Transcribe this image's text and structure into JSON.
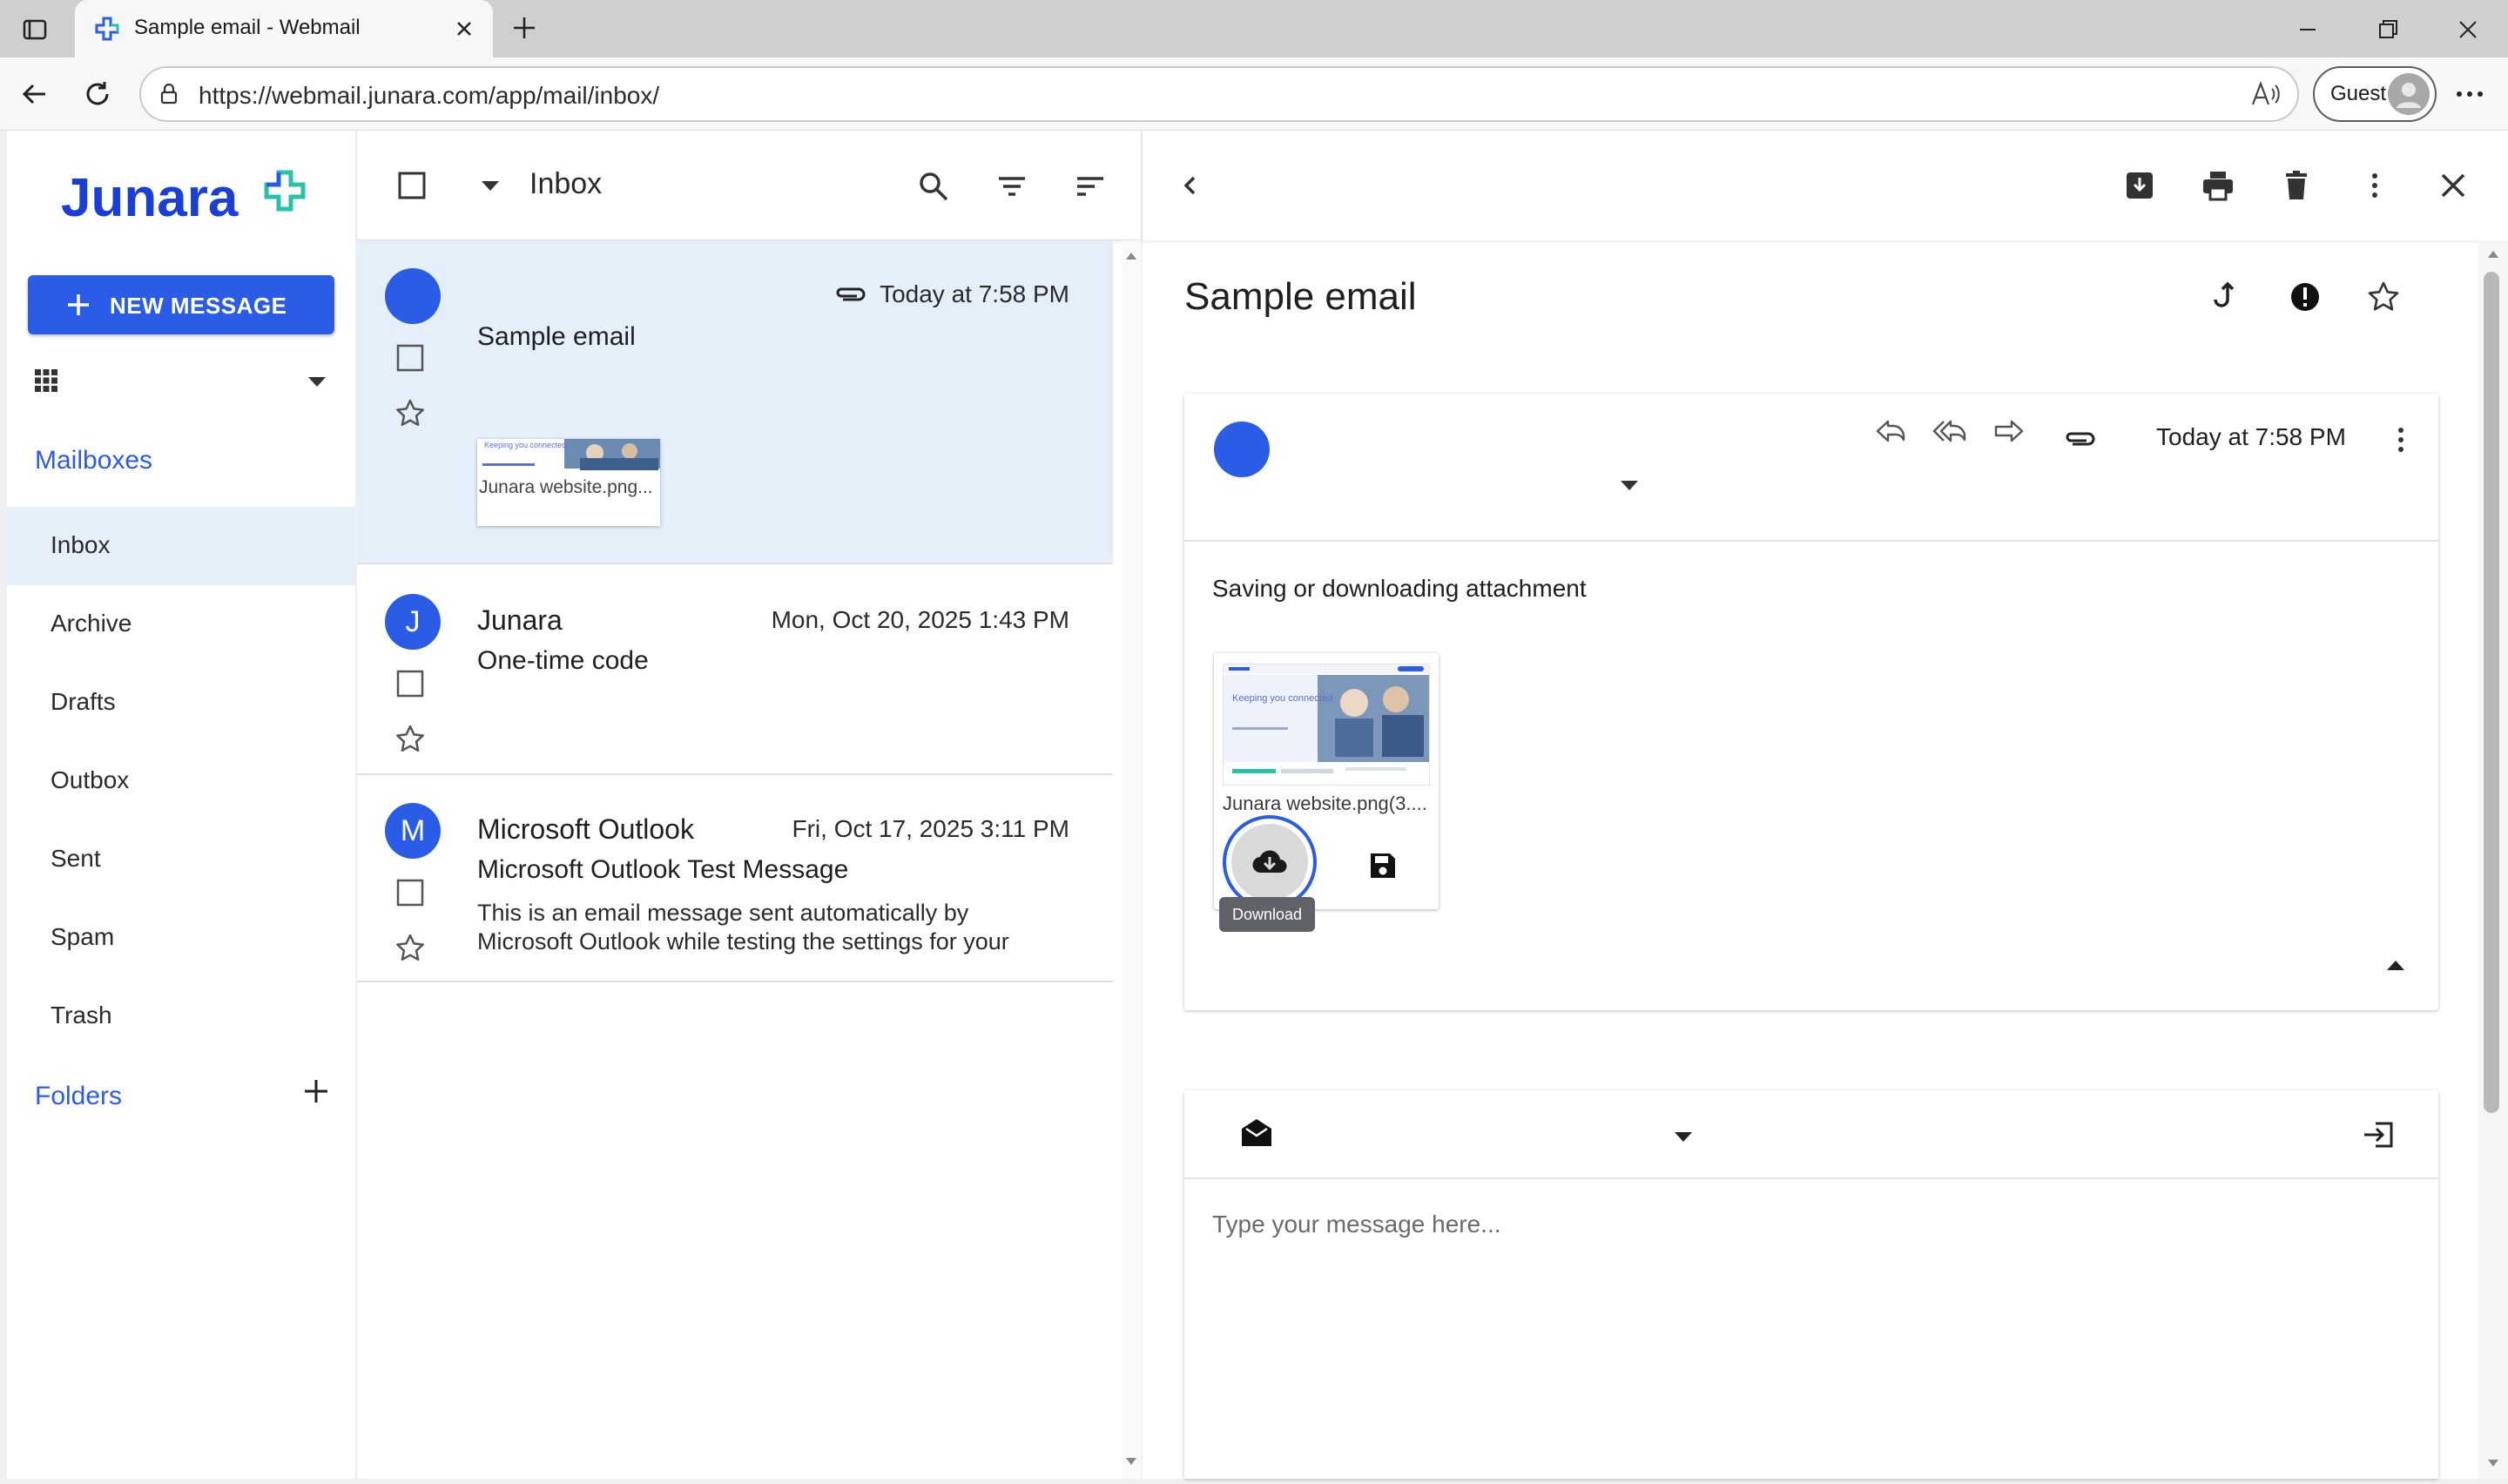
{
  "browser": {
    "tab_title": "Sample email - Webmail",
    "url": "https://webmail.junara.com/app/mail/inbox/",
    "profile_label": "Guest"
  },
  "colors": {
    "accent": "#2b5ce6",
    "selected_row": "#e4effa",
    "logo_green": "#27c3a8"
  },
  "sidebar": {
    "logo_text": "Junara",
    "new_message_label": "NEW MESSAGE",
    "mailboxes_title": "Mailboxes",
    "mailboxes": [
      {
        "label": "Inbox",
        "active": true
      },
      {
        "label": "Archive"
      },
      {
        "label": "Drafts"
      },
      {
        "label": "Outbox"
      },
      {
        "label": "Sent"
      },
      {
        "label": "Spam"
      },
      {
        "label": "Trash"
      }
    ],
    "folders_title": "Folders"
  },
  "list": {
    "title": "Inbox",
    "messages": [
      {
        "avatar_letter": "",
        "sender": "",
        "date": "Today at 7:58 PM",
        "subject": "Sample email",
        "has_attachment": true,
        "attachment_label": "Junara website.png...",
        "thumb_text": "Keeping you connected"
      },
      {
        "avatar_letter": "J",
        "sender": "Junara",
        "date": "Mon, Oct 20, 2025 1:43 PM",
        "subject": "One-time code"
      },
      {
        "avatar_letter": "M",
        "sender": "Microsoft Outlook",
        "date": "Fri, Oct 17, 2025 3:11 PM",
        "subject": "Microsoft Outlook Test Message",
        "preview": "This is an email message sent automatically by Microsoft Outlook while testing the settings for your"
      }
    ]
  },
  "reader": {
    "subject": "Sample email",
    "date": "Today at 7:58 PM",
    "body": "Saving or downloading attachment",
    "attachment": {
      "name": "Junara website.png(3....",
      "thumb_headline": "Keeping you connected",
      "tooltip": "Download"
    },
    "compose_placeholder": "Type your message here..."
  }
}
